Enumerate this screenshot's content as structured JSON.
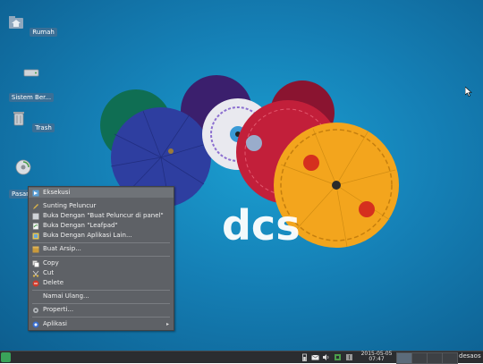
{
  "desktop": {
    "icons": [
      {
        "name": "home-folder",
        "label": "Rumah",
        "icon": "folder-home-icon"
      },
      {
        "name": "filesystem",
        "label": "Sistem Ber...",
        "icon": "drive-icon"
      },
      {
        "name": "trash",
        "label": "Trash",
        "icon": "trash-icon"
      },
      {
        "name": "installer",
        "label": "Pasang Desa...",
        "icon": "install-disc-icon"
      }
    ],
    "wallpaper_logo": "dcs"
  },
  "context_menu": {
    "items": [
      {
        "label": "Eksekusi",
        "icon": "execute-icon",
        "highlighted": true
      },
      {
        "label": "Sunting Peluncur",
        "icon": "edit-launcher-icon"
      },
      {
        "label": "Buka Dengan \"Buat Peluncur di panel\"",
        "icon": "panel-icon"
      },
      {
        "label": "Buka Dengan \"Leafpad\"",
        "icon": "leafpad-icon"
      },
      {
        "label": "Buka Dengan Aplikasi Lain...",
        "icon": "open-with-icon"
      },
      {
        "label": "Buat Arsip...",
        "icon": "archive-icon"
      },
      {
        "label": "Copy",
        "icon": "copy-icon"
      },
      {
        "label": "Cut",
        "icon": "cut-icon"
      },
      {
        "label": "Delete",
        "icon": "delete-icon"
      },
      {
        "label": "Namai Ulang...",
        "icon": ""
      },
      {
        "label": "Properti...",
        "icon": "properties-icon"
      },
      {
        "label": "Aplikasi",
        "icon": "applications-icon",
        "submenu": true
      }
    ]
  },
  "panel": {
    "clock_date": "2015-05-05",
    "clock_time": "07:47",
    "user": "desaos",
    "workspaces": 4,
    "active_workspace": 1
  },
  "colors": {
    "desktop_blue": "#1580b6",
    "menu_bg": "#5e6166",
    "panel_bg": "#2b2d30",
    "icon_label_bg": "#3a6f96"
  }
}
